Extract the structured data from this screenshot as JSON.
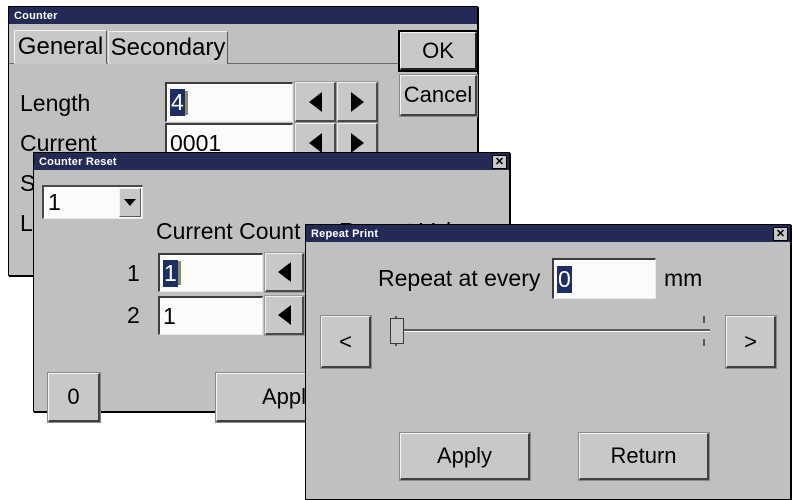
{
  "counter_window": {
    "title": "Counter",
    "tabs": [
      {
        "label": "General",
        "active": true
      },
      {
        "label": "Secondary",
        "active": false
      }
    ],
    "fields": [
      {
        "label": "Length",
        "value": "4",
        "selected": true,
        "dec_icon": "triangle-left-icon",
        "inc_icon": "triangle-right-icon"
      },
      {
        "label": "Current",
        "value": "0001",
        "selected": false,
        "dec_icon": "triangle-left-icon",
        "inc_icon": "triangle-right-icon"
      }
    ],
    "occluded_labels": [
      {
        "text": "St"
      },
      {
        "text": "Lin"
      }
    ],
    "buttons": [
      {
        "label": "OK",
        "default": true
      },
      {
        "label": "Cancel",
        "default": false
      }
    ]
  },
  "counter_reset_window": {
    "title": "Counter Reset",
    "close_icon": "close-icon",
    "selector": {
      "value": "1",
      "chevron_icon": "chevron-down-icon"
    },
    "column_headers": [
      {
        "text": "Current Count"
      },
      {
        "text": "Repeat Value"
      }
    ],
    "rows": [
      {
        "index": "1",
        "current_count": "1",
        "selected": true,
        "arrow_icon": "triangle-left-icon"
      },
      {
        "index": "2",
        "current_count": "1",
        "selected": false,
        "arrow_icon": "triangle-left-icon"
      }
    ],
    "buttons": [
      {
        "label": "0"
      },
      {
        "label": "Apply"
      }
    ]
  },
  "repeat_print_window": {
    "title": "Repeat Print",
    "close_icon": "close-icon",
    "prompt": "Repeat at every",
    "value": "0",
    "unit": "mm",
    "slider": {
      "value": 0,
      "min": 0,
      "max": 100,
      "thumb_position_percent": 0,
      "prev_label": "<",
      "next_label": ">"
    },
    "buttons": [
      {
        "label": "Apply"
      },
      {
        "label": "Return"
      }
    ]
  },
  "colors": {
    "titlebar": "#222a55",
    "window_face": "#c0c0c0",
    "button_face": "#c8c8c8",
    "field_bg": "#fbfbfb",
    "selection": "#1b2f66",
    "desktop": "#ffffff"
  }
}
